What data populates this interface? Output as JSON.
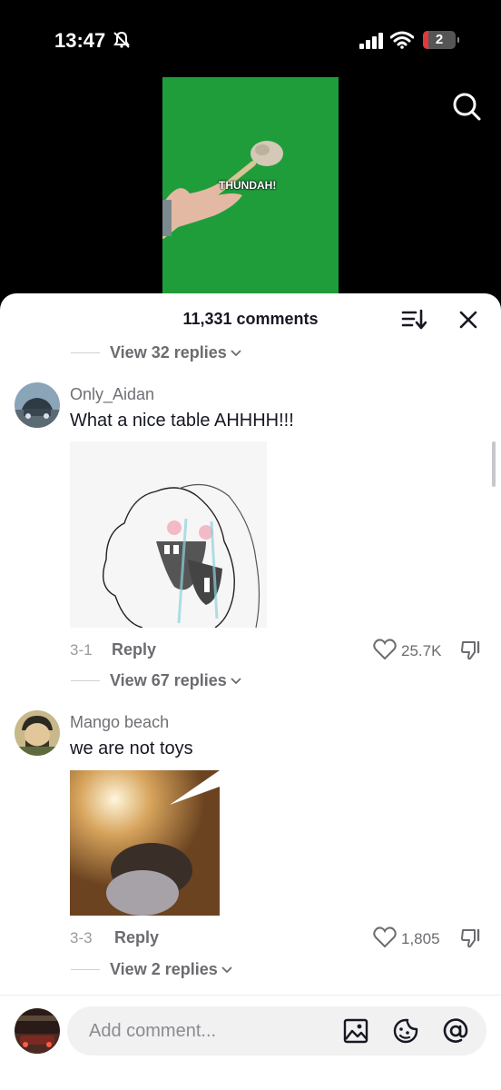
{
  "status_bar": {
    "time": "13:47",
    "battery": "2"
  },
  "video": {
    "caption": "THUNDAH!"
  },
  "sheet": {
    "title": "11,331 comments",
    "top_view_replies": "View 32 replies"
  },
  "comments": [
    {
      "username": "Only_Aidan",
      "text": "What a nice table AHHHH!!!",
      "date": "3-1",
      "reply_label": "Reply",
      "likes": "25.7K",
      "view_replies": "View 67 replies"
    },
    {
      "username": "Mango beach",
      "text": "we are not toys",
      "date": "3-3",
      "reply_label": "Reply",
      "likes": "1,805",
      "view_replies": "View 2 replies"
    }
  ],
  "input": {
    "placeholder": "Add comment..."
  },
  "icons": {
    "bell": "bell-slash-icon",
    "signal": "signal-icon",
    "wifi": "wifi-icon",
    "search": "search-icon",
    "sort": "sort-icon",
    "close": "close-icon",
    "heart": "heart-icon",
    "dislike": "thumbs-down-icon",
    "image": "image-icon",
    "emoji": "emoji-icon",
    "mention": "at-icon"
  }
}
